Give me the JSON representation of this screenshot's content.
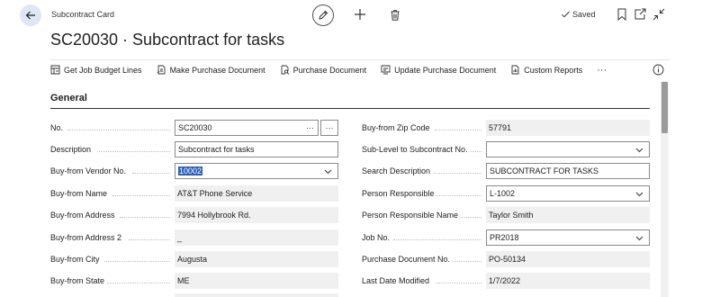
{
  "header": {
    "card_label": "Subcontract Card",
    "title": "SC20030 · Subcontract for tasks",
    "saved_label": "Saved"
  },
  "actions": [
    {
      "label": "Get Job Budget Lines",
      "icon": "budget-lines-icon"
    },
    {
      "label": "Make Purchase Document",
      "icon": "make-document-icon"
    },
    {
      "label": "Purchase Document",
      "icon": "document-search-icon"
    },
    {
      "label": "Update Purchase Document",
      "icon": "update-document-icon"
    },
    {
      "label": "Custom Reports",
      "icon": "report-icon"
    }
  ],
  "more_actions": "···",
  "section": {
    "title": "General"
  },
  "left_fields": [
    {
      "label": "No.",
      "value": "SC20030",
      "kind": "input-assist",
      "assist": "···"
    },
    {
      "label": "Description",
      "value": "Subcontract for tasks",
      "kind": "input"
    },
    {
      "label": "Buy-from Vendor No.",
      "value": "10002",
      "kind": "select-selected"
    },
    {
      "label": "Buy-from Name",
      "value": "AT&T Phone Service",
      "kind": "readonly"
    },
    {
      "label": "Buy-from Address",
      "value": "7994 Hollybrook Rd.",
      "kind": "readonly"
    },
    {
      "label": "Buy-from Address 2",
      "value": "_",
      "kind": "readonly"
    },
    {
      "label": "Buy-from City",
      "value": "Augusta",
      "kind": "readonly"
    },
    {
      "label": "Buy-from State",
      "value": "ME",
      "kind": "readonly"
    }
  ],
  "right_fields": [
    {
      "label": "Buy-from Zip Code",
      "value": "57791",
      "kind": "readonly"
    },
    {
      "label": "Sub-Level to Subcontract No.",
      "value": "",
      "kind": "select"
    },
    {
      "label": "Search Description",
      "value": "SUBCONTRACT FOR TASKS",
      "kind": "input"
    },
    {
      "label": "Person Responsible",
      "value": "L-1002",
      "kind": "select"
    },
    {
      "label": "Person Responsible Name",
      "value": "Taylor Smith",
      "kind": "readonly"
    },
    {
      "label": "Job No.",
      "value": "PR2018",
      "kind": "select"
    },
    {
      "label": "Purchase Document No.",
      "value": "PO-50134",
      "kind": "readonly"
    },
    {
      "label": "Last Date Modified",
      "value": "1/7/2022",
      "kind": "readonly"
    }
  ],
  "colors": {
    "accent": "#2a5fb8",
    "readonly_bg": "#f0f0f0",
    "back_button_bg": "#dfe6f4"
  }
}
